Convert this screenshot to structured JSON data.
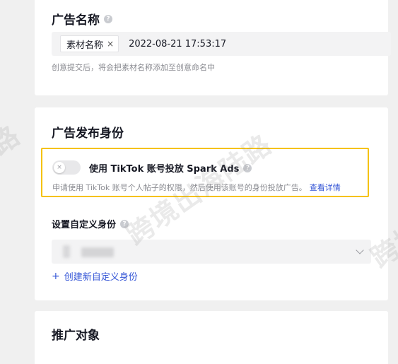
{
  "ad_name": {
    "title": "广告名称",
    "tag_label": "素材名称",
    "tag_close": "×",
    "value": "2022-08-21 17:53:17",
    "hint": "创意提交后，将会把素材名称添加至创意命名中"
  },
  "identity": {
    "title": "广告发布身份",
    "spark_label": "使用 TikTok 账号投放 Spark Ads",
    "spark_desc": "申请使用 TikTok 账号个人帖子的权限，然后使用该账号的身份投放广告。",
    "spark_link": "查看详情",
    "spark_enabled": false,
    "custom_label": "设置自定义身份",
    "create_plus": "+",
    "create_label": "创建新自定义身份"
  },
  "promo": {
    "title": "推广对象"
  },
  "watermark": {
    "text_main": "跨境出海陆路",
    "text_left": "路",
    "text_right": "跨境"
  },
  "icons": {
    "help": "?",
    "toggle_off": "×"
  },
  "colors": {
    "highlight_border": "#f5c20a",
    "link": "#3455d6",
    "toggle_off": "#e8e8ea"
  }
}
